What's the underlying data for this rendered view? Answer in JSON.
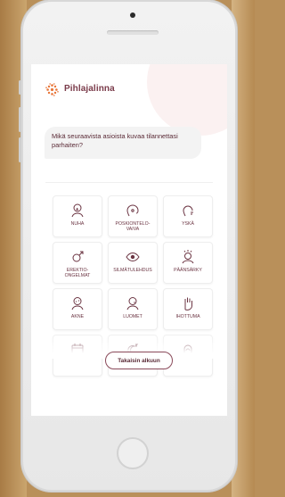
{
  "header": {
    "brand": "Pihlajalinna",
    "logo_icon": "pihlajalinna-logo-icon"
  },
  "question": {
    "text": "Mikä seuraavista asioista kuvaa tilannettasi parhaiten?"
  },
  "symptoms": [
    {
      "label": "NUHA",
      "icon": "nose-person-icon"
    },
    {
      "label": "POSKIONTELO-VAIVA",
      "icon": "head-sinus-icon"
    },
    {
      "label": "YSKÄ",
      "icon": "cough-icon"
    },
    {
      "label": "EREKTIO-ONGELMAT",
      "icon": "gender-symbol-icon"
    },
    {
      "label": "SILMÄTULEHDUS",
      "icon": "eye-icon"
    },
    {
      "label": "PÄÄNSÄRKY",
      "icon": "headache-icon"
    },
    {
      "label": "AKNE",
      "icon": "acne-person-icon"
    },
    {
      "label": "LUOMET",
      "icon": "mole-person-icon"
    },
    {
      "label": "IHOTTUMA",
      "icon": "hand-rash-icon"
    },
    {
      "label": "",
      "icon": "calendar-icon"
    },
    {
      "label": "",
      "icon": "sleep-moon-icon"
    },
    {
      "label": "",
      "icon": "hair-icon"
    }
  ],
  "actions": {
    "back_label": "Takaisin alkuun"
  },
  "colors": {
    "accent": "#7a3b4a",
    "logo": "#e8763a"
  }
}
